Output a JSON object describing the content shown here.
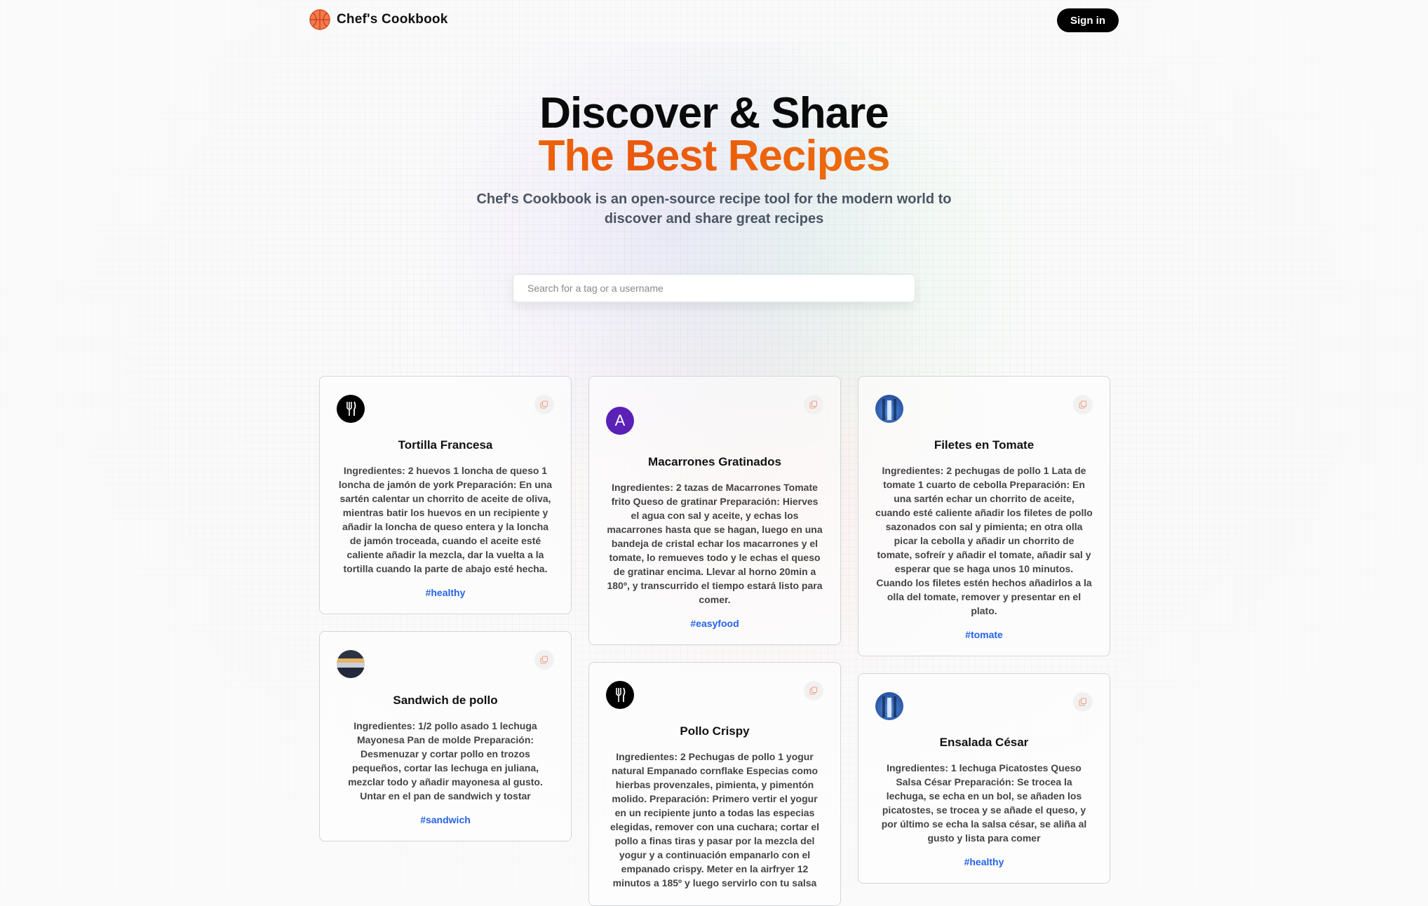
{
  "nav": {
    "brand": "Chef's Cookbook",
    "signin_label": "Sign in"
  },
  "hero": {
    "title_line1": "Discover & Share",
    "title_line2": "The Best Recipes",
    "description": "Chef's Cookbook is an open-source recipe tool for the modern world to discover and share great recipes"
  },
  "search": {
    "placeholder": "Search for a tag or a username",
    "value": ""
  },
  "recipes": [
    {
      "title": "Tortilla Francesa",
      "avatar": "fork-knife-logo",
      "body": "Ingredientes: 2 huevos 1 loncha de queso 1 loncha de jamón de york Preparación: En una sartén calentar un chorrito de aceite de oliva, mientras batir los huevos en un recipiente y añadir la loncha de queso entera y la loncha de jamón troceada, cuando el aceite esté caliente añadir la mezcla, dar la vuelta a la tortilla cuando la parte de abajo esté hecha.",
      "tag": "#healthy"
    },
    {
      "title": "Macarrones Gratinados",
      "avatar": "letter-avatar",
      "avatar_letter": "A",
      "body": "Ingredientes: 2 tazas de Macarrones Tomate frito Queso de gratinar Preparación: Hierves el agua con sal y aceite, y echas los macarrones hasta que se hagan, luego en una bandeja de cristal echar los macarrones y el tomate, lo remueves todo y le echas el queso de gratinar encima. Llevar al horno 20min a 180º, y transcurrido el tiempo estará listo para comer.",
      "tag": "#easyfood"
    },
    {
      "title": "Filetes en Tomate",
      "avatar": "blue-photo-avatar",
      "body": "Ingredientes: 2 pechugas de pollo 1 Lata de tomate 1 cuarto de cebolla Preparación: En una sartén echar un chorrito de aceite, cuando esté caliente añadir los filetes de pollo sazonados con sal y pimienta; en otra olla picar la cebolla y añadir un chorrito de tomate, sofreír y añadir el tomate, añadir sal y esperar que se haga unos 10 minutos. Cuando los filetes estén hechos añadirlos a la olla del tomate, remover y presentar en el plato.",
      "tag": "#tomate"
    },
    {
      "title": "Sandwich de pollo",
      "avatar": "photo-avatar",
      "body": "Ingredientes: 1/2 pollo asado 1 lechuga Mayonesa Pan de molde Preparación: Desmenuzar y cortar pollo en trozos pequeños, cortar las lechuga en juliana, mezclar todo y añadir mayonesa al gusto. Untar en el pan de sandwich y tostar",
      "tag": "#sandwich"
    },
    {
      "title": "Pollo Crispy",
      "avatar": "fork-knife-logo",
      "body": "Ingredientes: 2 Pechugas de pollo 1 yogur natural Empanado cornflake Especias como hierbas provenzales, pimienta, y pimentón molido. Preparación: Primero vertir el yogur en un recipiente junto a todas las especias elegidas, remover con una cuchara; cortar el pollo a finas tiras y pasar por la mezcla del yogur y a continuación empanarlo con el empanado crispy. Meter en la airfryer 12 minutos a 185º y luego servirlo con tu salsa",
      "tag": ""
    },
    {
      "title": "Ensalada César",
      "avatar": "blue-photo-avatar",
      "body": "Ingredientes: 1 lechuga Picatostes Queso Salsa César Preparación: Se trocea la lechuga, se echa en un bol, se añaden los picatostes, se trocea y se añade el queso, y por último se echa la salsa césar, se aliña al gusto y lista para comer",
      "tag": "#healthy"
    }
  ],
  "colors": {
    "accent_orange": "#ea580c",
    "accent_amber": "#f59e0b",
    "tag_blue": "#2563eb",
    "signin_bg": "#000000"
  }
}
